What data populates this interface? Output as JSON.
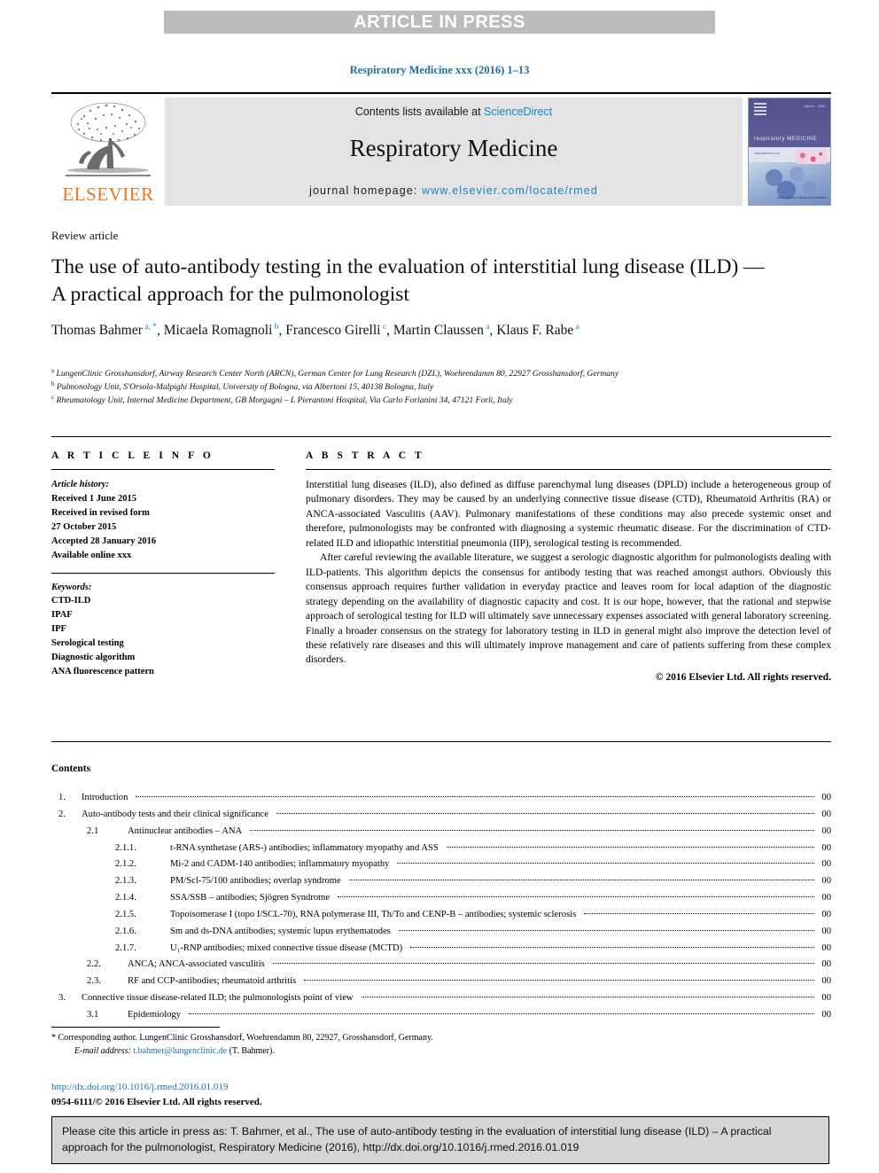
{
  "banner": {
    "text": "ARTICLE IN PRESS"
  },
  "running_head": {
    "text": "Respiratory Medicine xxx (2016) 1–13"
  },
  "masthead": {
    "contents_prefix": "Contents lists available at ",
    "sciencedirect": "ScienceDirect",
    "journal_name": "Respiratory Medicine",
    "homepage_prefix": "journal homepage: ",
    "homepage_url": "www.elsevier.com/locate/rmed",
    "publisher_wordmark": "ELSEVIER",
    "cover": {
      "title": "respiratory MEDICINE",
      "tagline": "www.elsevier.com",
      "issue": "Volume ... 2016",
      "footer": "Official Journal of\nRespiratory Medicine"
    },
    "colors": {
      "accent_link": "#1a84c7",
      "elsevier_orange": "#e87722",
      "band_grey": "#e3e3e3"
    }
  },
  "article": {
    "kicker": "Review article",
    "title": "The use of auto-antibody testing in the evaluation of interstitial lung disease (ILD) — A practical approach for the pulmonologist",
    "authors": [
      {
        "name": "Thomas Bahmer",
        "marks": "a, *",
        "sep": ", "
      },
      {
        "name": "Micaela Romagnoli",
        "marks": "b",
        "sep": ", "
      },
      {
        "name": "Francesco Girelli",
        "marks": "c",
        "sep": ", "
      },
      {
        "name": "Martin Claussen",
        "marks": "a",
        "sep": ","
      },
      {
        "name": "Klaus F. Rabe",
        "marks": "a",
        "sep": ""
      }
    ],
    "affiliations": [
      {
        "mark": "a",
        "text": "LungenClinic Grosshansdorf, Airway Research Center North (ARCN), German Center for Lung Research (DZL), Woehrendamm 80, 22927 Grosshansdorf, Germany"
      },
      {
        "mark": "b",
        "text": "Pulmonology Unit, S'Orsola-Malpighi Hospital, University of Bologna, via Albertoni 15, 40138 Bologna, Italy"
      },
      {
        "mark": "c",
        "text": "Rheumatology Unit, Internal Medicine Department, GB Morgagni – L Pierantoni Hospital, Via Carlo Forlanini 34, 47121 Forlì, Italy"
      }
    ]
  },
  "article_info": {
    "heading": "A R T I C L E  I N F O",
    "history_heading": "Article history:",
    "history": [
      "Received 1 June 2015",
      "Received in revised form",
      "27 October 2015",
      "Accepted 28 January 2016",
      "Available online xxx"
    ],
    "keywords_heading": "Keywords:",
    "keywords": [
      "CTD-ILD",
      "IPAF",
      "IPF",
      "Serological testing",
      "Diagnostic algorithm",
      "ANA fluorescence pattern"
    ]
  },
  "abstract": {
    "heading": "A B S T R A C T",
    "paragraphs": [
      "Interstitial lung diseases (ILD), also defined as diffuse parenchymal lung diseases (DPLD) include a heterogeneous group of pulmonary disorders. They may be caused by an underlying connective tissue disease (CTD), Rheumatoid Arthritis (RA) or ANCA-associated Vasculitis (AAV). Pulmonary manifestations of these conditions may also precede systemic onset and therefore, pulmonologists may be confronted with diagnosing a systemic rheumatic disease. For the discrimination of CTD-related ILD and idiopathic interstitial pneumonia (IIP), serological testing is recommended.",
      "After careful reviewing the available literature, we suggest a serologic diagnostic algorithm for pulmonologists dealing with ILD-patients. This algorithm depicts the consensus for antibody testing that was reached amongst authors. Obviously this consensus approach requires further validation in everyday practice and leaves room for local adaption of the diagnostic strategy depending on the availability of diagnostic capacity and cost. It is our hope, however, that the rational and stepwise approach of serological testing for ILD will ultimately save unnecessary expenses associated with general laboratory screening. Finally a broader consensus on the strategy for laboratory testing in ILD in general might also improve the detection level of these relatively rare diseases and this will ultimately improve management and care of patients suffering from these complex disorders."
    ],
    "copyright": "© 2016 Elsevier Ltd. All rights reserved."
  },
  "contents": {
    "heading": "Contents",
    "entries": [
      {
        "level": 1,
        "num": "1.",
        "label": "Introduction",
        "page": "00"
      },
      {
        "level": 1,
        "num": "2.",
        "label": "Auto-antibody tests and their clinical significance",
        "page": "00"
      },
      {
        "level": 2,
        "num": "2.1",
        "label": "Antinuclear antibodies – ANA",
        "page": "00"
      },
      {
        "level": 3,
        "num": "2.1.1.",
        "label": "t-RNA synthetase (ARS-) antibodies; inflammatory myopathy and ASS",
        "page": "00"
      },
      {
        "level": 3,
        "num": "2.1.2.",
        "label": "Mi-2 and CADM-140 antibodies; inflammatory myopathy",
        "page": "00"
      },
      {
        "level": 3,
        "num": "2.1.3.",
        "label": "PM/Scl-75/100 antibodies; overlap syndrome",
        "page": "00"
      },
      {
        "level": 3,
        "num": "2.1.4.",
        "label": "SSA/SSB – antibodies; Sjögren Syndrome",
        "page": "00"
      },
      {
        "level": 3,
        "num": "2.1.5.",
        "label": "Topoisomerase I (topo I/SCL-70), RNA polymerase III, Th/To and CENP-B – antibodies; systemic sclerosis",
        "page": "00"
      },
      {
        "level": 3,
        "num": "2.1.6.",
        "label": "Sm and ds-DNA antibodies; systemic lupus erythematodes",
        "page": "00"
      },
      {
        "level": 3,
        "num": "2.1.7.",
        "label": "U₁-RNP antibodies; mixed connective tissue disease (MCTD)",
        "page": "00"
      },
      {
        "level": 2,
        "num": "2.2.",
        "label": "ANCA; ANCA-associated vasculitis",
        "page": "00"
      },
      {
        "level": 2,
        "num": "2.3.",
        "label": "RF and CCP-antibodies; rheumatoid arthritis",
        "page": "00"
      },
      {
        "level": 1,
        "num": "3.",
        "label": "Connective tissue disease-related ILD; the pulmonologists point of view",
        "page": "00"
      },
      {
        "level": 2,
        "num": "3.1",
        "label": "Epidemiology",
        "page": "00"
      }
    ]
  },
  "footnotes": {
    "corresponding": "* Corresponding author. LungenClinic Grosshansdorf, Woehrendamm 80, 22927, Grosshansdorf, Germany.",
    "email_label": "E-mail address:",
    "email_value": "t.bahmer@lungenclinic.de",
    "email_owner": "(T. Bahmer).",
    "doi": "http://dx.doi.org/10.1016/j.rmed.2016.01.019",
    "issn_line": "0954-6111/© 2016 Elsevier Ltd. All rights reserved."
  },
  "citation": {
    "text": "Please cite this article in press as: T. Bahmer, et al., The use of auto-antibody testing in the evaluation of interstitial lung disease (ILD) – A practical approach for the pulmonologist, Respiratory Medicine (2016), http://dx.doi.org/10.1016/j.rmed.2016.01.019"
  }
}
